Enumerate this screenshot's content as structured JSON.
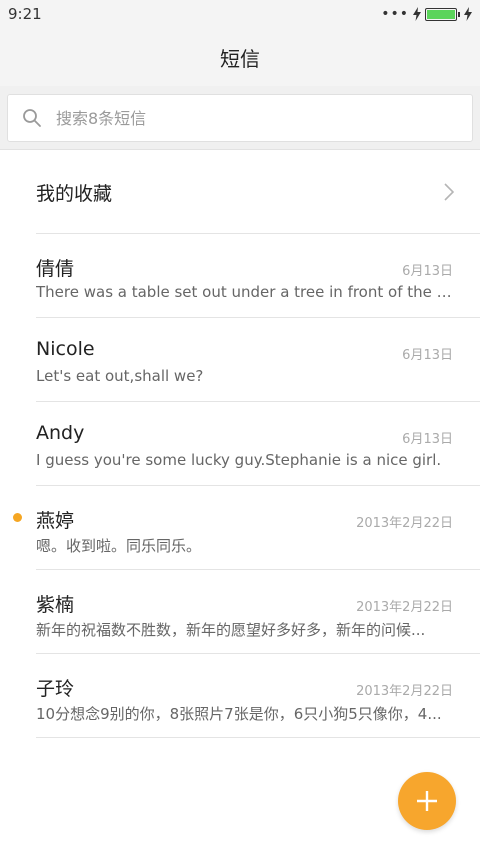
{
  "status": {
    "time": "9:21",
    "battery_level": 1.0,
    "icons": [
      "more-dots-icon",
      "charging-icon",
      "battery-icon",
      "charging-icon"
    ]
  },
  "header": {
    "title": "短信"
  },
  "search": {
    "placeholder": "搜索8条短信",
    "value": ""
  },
  "favorites": {
    "label": "我的收藏"
  },
  "conversations": [
    {
      "name": "倩倩",
      "date": "6月13日",
      "preview": "There was a table set out under a tree in front of the house...",
      "unread": false
    },
    {
      "name": "Nicole",
      "date": "6月13日",
      "preview": "Let's eat out,shall we?",
      "unread": false
    },
    {
      "name": "Andy",
      "date": "6月13日",
      "preview": "I guess you're some lucky guy.Stephanie is a nice girl.",
      "unread": false
    },
    {
      "name": "燕婷",
      "date": "2013年2月22日",
      "preview": "嗯。收到啦。同乐同乐。",
      "unread": true
    },
    {
      "name": "紫楠",
      "date": "2013年2月22日",
      "preview": "新年的祝福数不胜数，新年的愿望好多好多，新年的问候...",
      "unread": false
    },
    {
      "name": "子玲",
      "date": "2013年2月22日",
      "preview": "10分想念9别的你，8张照片7张是你，6只小狗5只像你，4...",
      "unread": false
    }
  ],
  "colors": {
    "accent": "#f7a62d",
    "unread_dot": "#f5a623",
    "battery": "#5ad45a"
  },
  "fab": {
    "icon": "plus-icon"
  }
}
